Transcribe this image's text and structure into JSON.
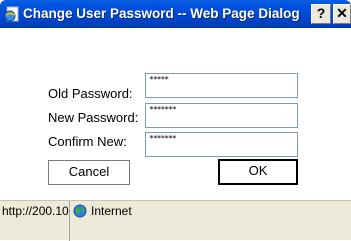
{
  "window": {
    "title": "Change User Password -- Web Page Dialog",
    "help_label": "?",
    "close_label": "✕"
  },
  "form": {
    "old_password": {
      "label": "Old Password:",
      "value": "*****"
    },
    "new_password": {
      "label": "New Password:",
      "value": "*******"
    },
    "confirm_new": {
      "label": "Confirm New:",
      "value": "*******"
    }
  },
  "buttons": {
    "cancel_label": "Cancel",
    "ok_label": "OK"
  },
  "statusbar": {
    "url": "http://200.10.",
    "zone": "Internet"
  },
  "icons": {
    "app": "ie-page-icon",
    "zone": "internet-globe-icon"
  },
  "colors": {
    "titlebar": "#0054e3",
    "statusbar": "#ece9d8",
    "input_border": "#7f9db9"
  }
}
